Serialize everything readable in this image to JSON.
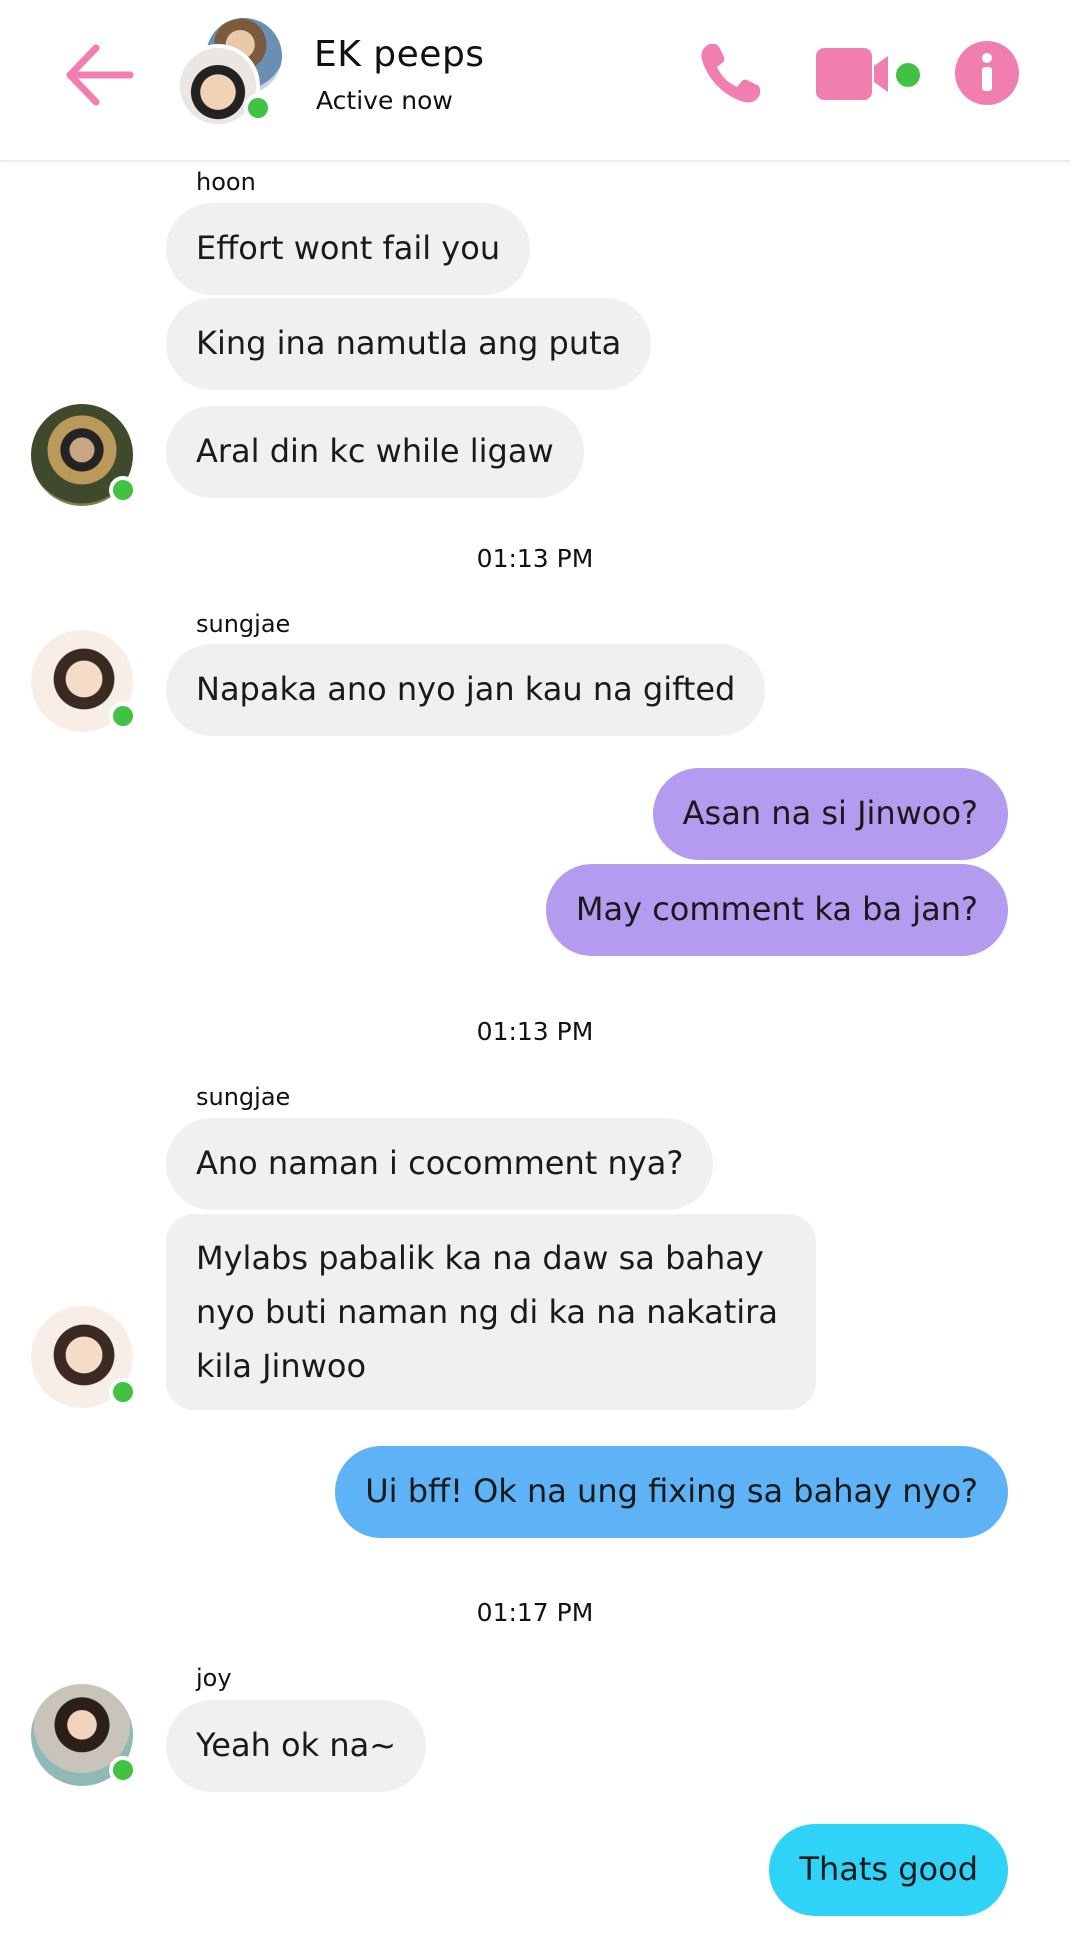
{
  "header": {
    "title": "EK peeps",
    "status": "Active now",
    "accent_color": "#f07fb0",
    "online_color": "#42c242"
  },
  "messages": [
    {
      "sender": "hoon",
      "text": "Effort wont fail you"
    },
    {
      "text": "King ina namutla ang puta"
    },
    {
      "text": "Aral din kc while ligaw"
    },
    {
      "timestamp": "01:13 PM"
    },
    {
      "sender": "sungjae",
      "text": "Napaka ano nyo jan kau na gifted"
    },
    {
      "outgoing": true,
      "text": "Asan na si Jinwoo?"
    },
    {
      "outgoing": true,
      "text": "May comment ka ba jan?"
    },
    {
      "timestamp": "01:13 PM"
    },
    {
      "sender": "sungjae",
      "text": "Ano naman i cocomment nya?"
    },
    {
      "text": "Mylabs pabalik ka na daw sa bahay nyo buti naman ng di ka na nakatira kila Jinwoo"
    },
    {
      "outgoing": true,
      "text": "Ui bff! Ok na ung fixing sa bahay nyo?"
    },
    {
      "timestamp": "01:17 PM"
    },
    {
      "sender": "joy",
      "text": "Yeah ok na~"
    },
    {
      "outgoing": true,
      "text": "Thats good"
    }
  ],
  "icons": {
    "back": "back-arrow-icon",
    "phone": "phone-icon",
    "video": "video-camera-icon",
    "info": "info-icon"
  }
}
